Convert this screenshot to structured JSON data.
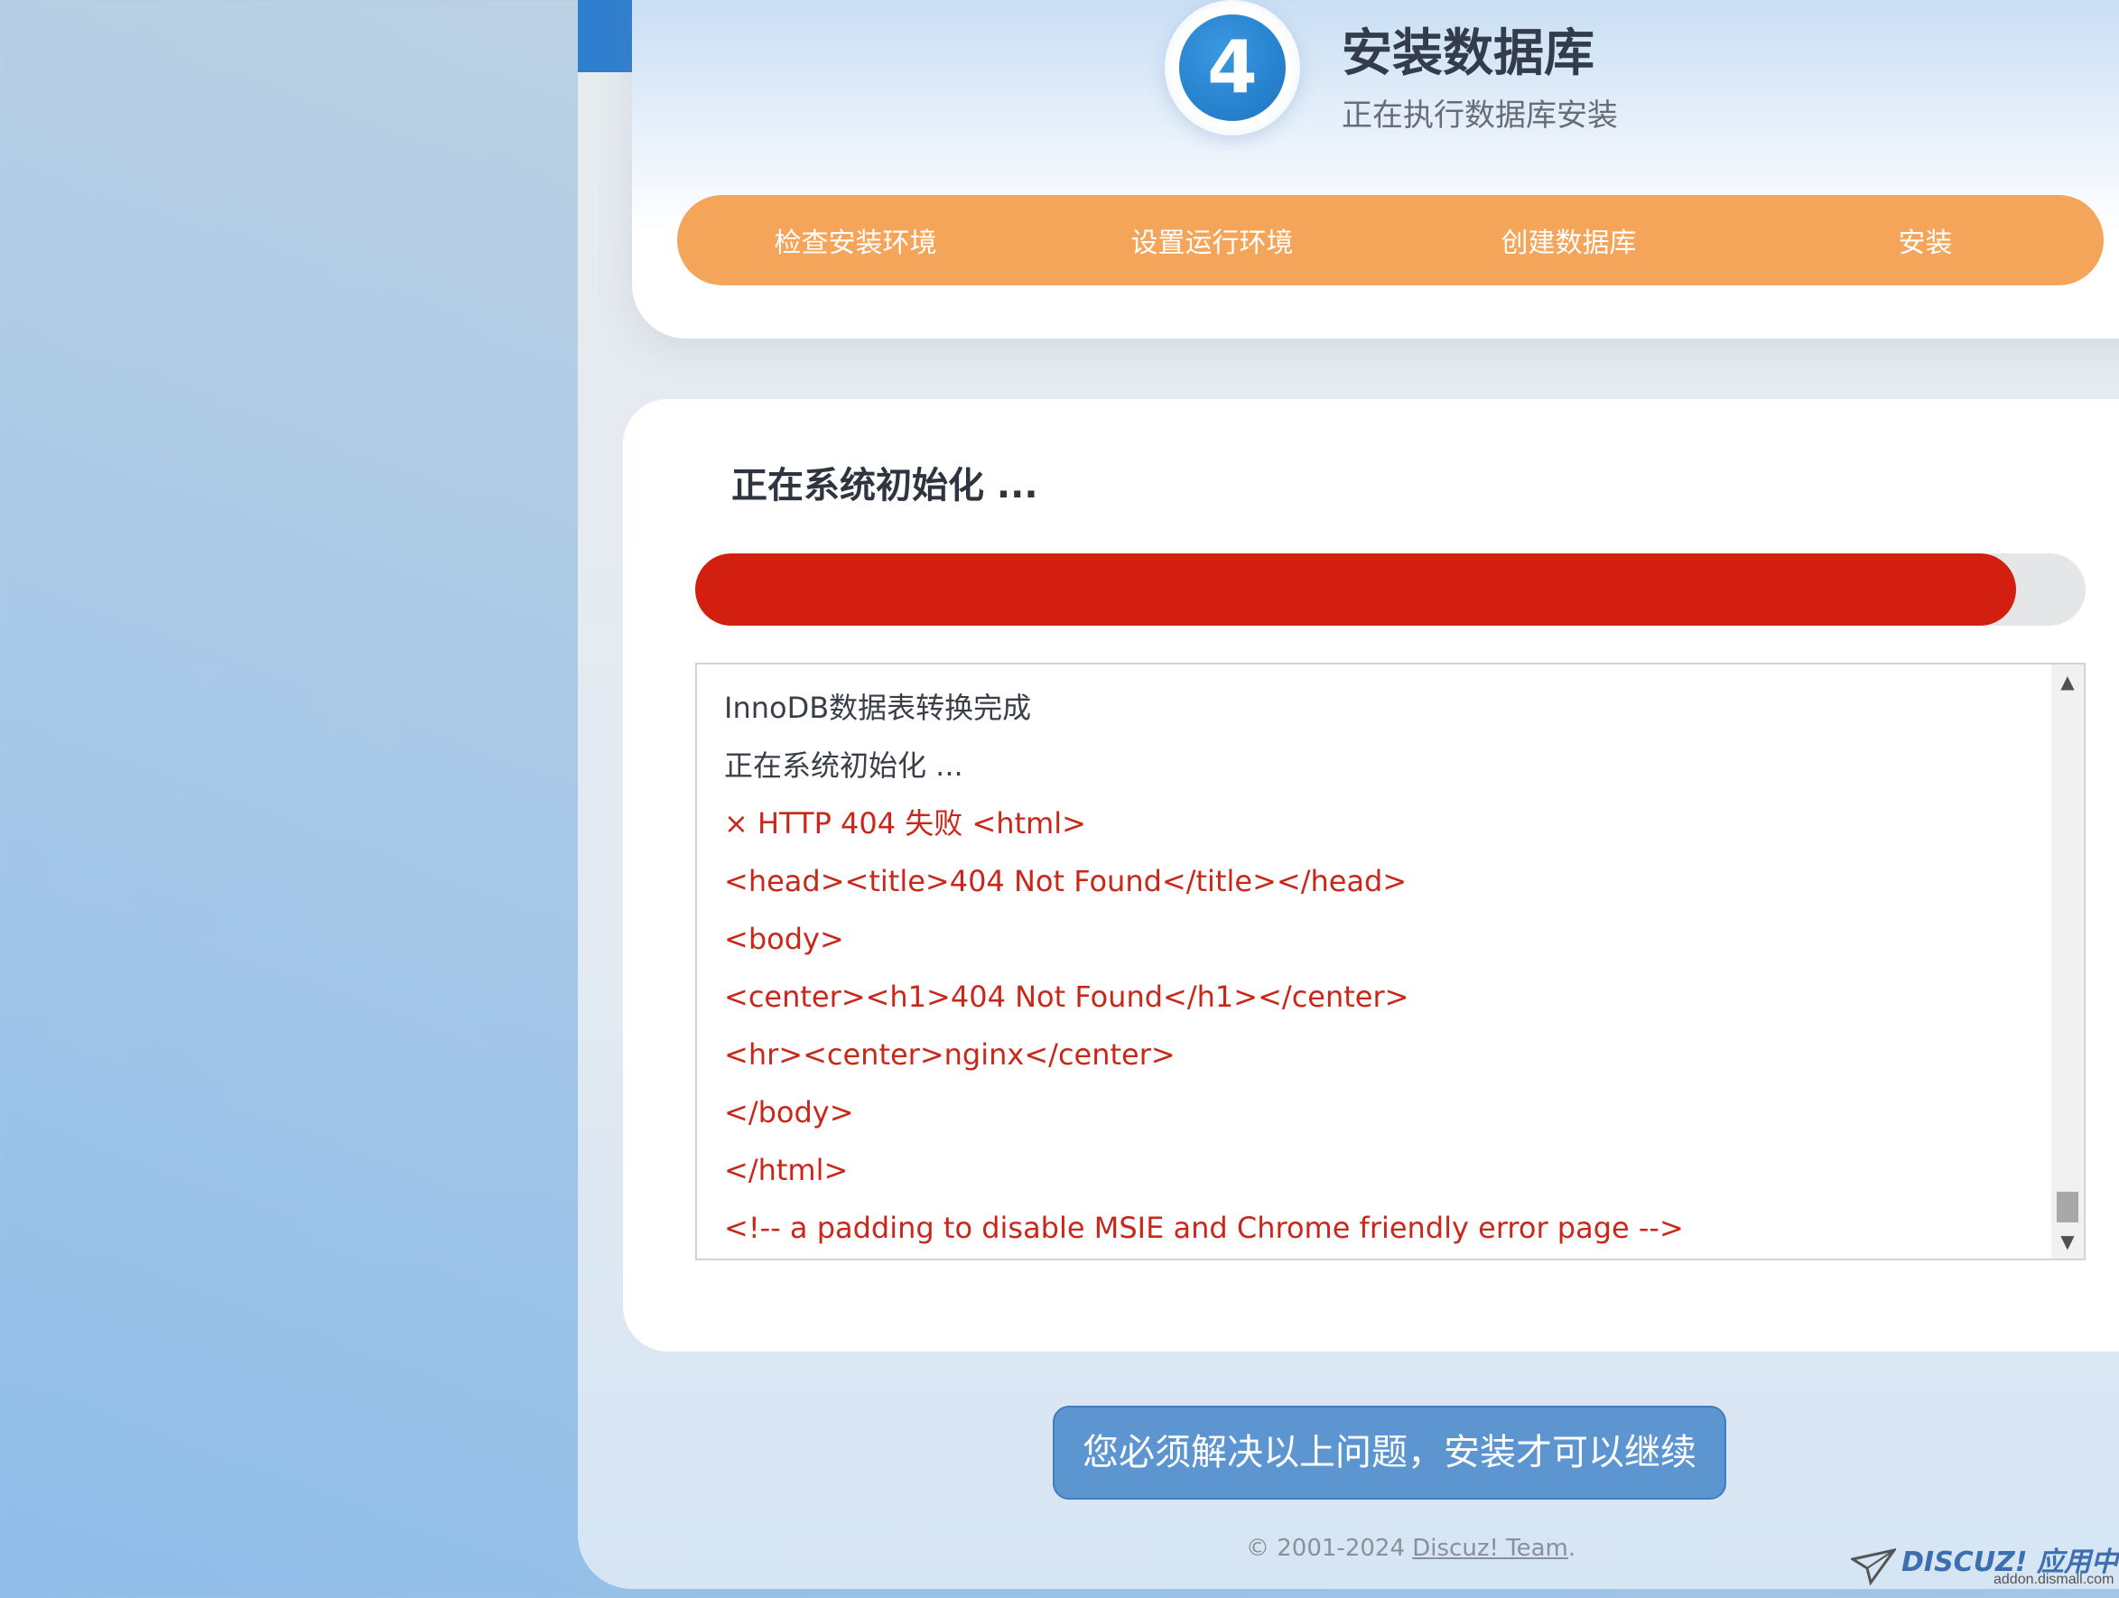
{
  "header": {
    "step_number": "4",
    "title": "安装数据库",
    "subtitle": "正在执行数据库安装"
  },
  "steps_bar": {
    "items": [
      {
        "label": "检查安装环境"
      },
      {
        "label": "设置运行环境"
      },
      {
        "label": "创建数据库"
      },
      {
        "label": "安装"
      }
    ]
  },
  "content": {
    "title": "正在系统初始化 ...",
    "progress": 0.95,
    "log": [
      {
        "text": "InnoDB数据表转换完成",
        "type": "ok"
      },
      {
        "text": "正在系统初始化 ...",
        "type": "ok"
      },
      {
        "text": "× HTTP 404 失败 <html>",
        "type": "err"
      },
      {
        "text": "<head><title>404 Not Found</title></head>",
        "type": "err"
      },
      {
        "text": "<body>",
        "type": "err"
      },
      {
        "text": "<center><h1>404 Not Found</h1></center>",
        "type": "err"
      },
      {
        "text": "<hr><center>nginx</center>",
        "type": "err"
      },
      {
        "text": "</body>",
        "type": "err"
      },
      {
        "text": "</html>",
        "type": "err"
      },
      {
        "text": "<!-- a padding to disable MSIE and Chrome friendly error page -->",
        "type": "err"
      }
    ]
  },
  "action": {
    "label": "您必须解决以上问题，安装才可以继续"
  },
  "footer": {
    "copyright": "© 2001-2024 ",
    "link": "Discuz! Team",
    "suffix": "."
  },
  "watermark": {
    "brand": "DISCUZ! 应用中心",
    "url": "addon.dismall.com"
  },
  "colors": {
    "accent_blue": "#1c74c2",
    "steps_orange": "#f5a55a",
    "progress_red": "#d31f10",
    "error_text": "#c9271a",
    "button_blue": "#5c95d0"
  }
}
